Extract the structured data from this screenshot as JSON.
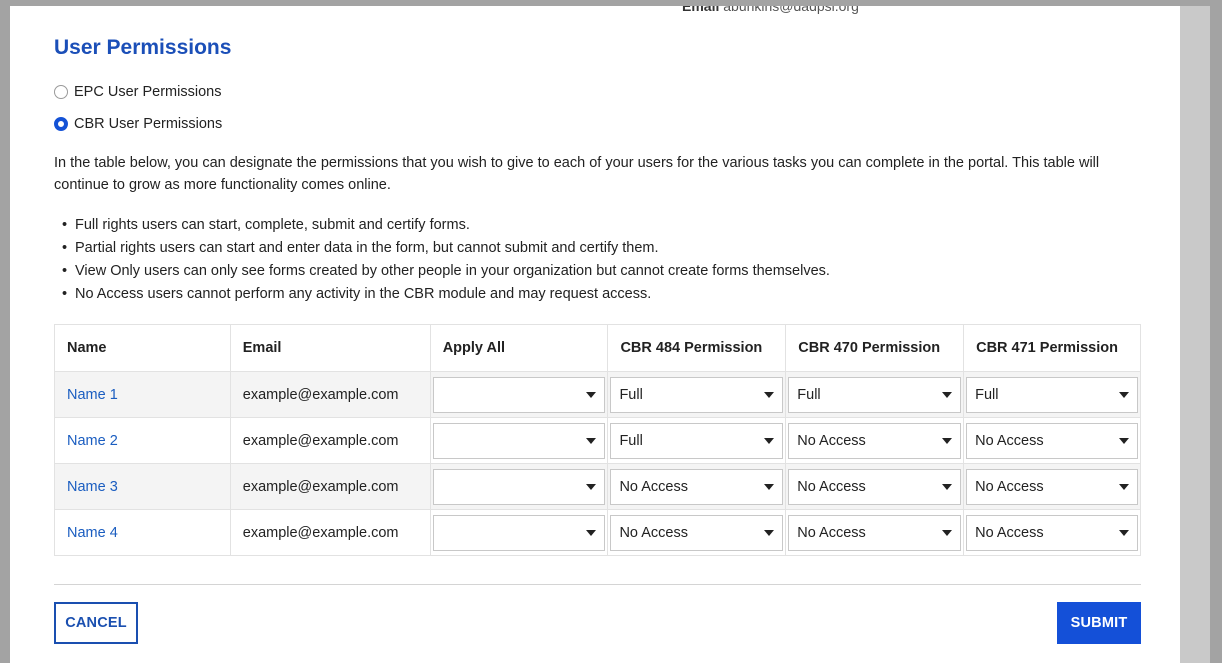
{
  "header": {
    "email_label": "Email",
    "email_value": "abunkins@dadpsi.org"
  },
  "page_title": "User Permissions",
  "permission_types": [
    {
      "label": "EPC User Permissions",
      "selected": false
    },
    {
      "label": "CBR User Permissions",
      "selected": true
    }
  ],
  "description": "In the table below, you can designate the permissions that you wish to give to each of your users for the various tasks you can complete in the portal. This table will continue to grow as more functionality comes online.",
  "bullets": [
    "Full rights users can start, complete, submit and certify forms.",
    "Partial rights users can start and enter data in the form, but cannot submit and certify them.",
    "View Only users can only see forms created by other people in your organization but cannot create forms themselves.",
    "No Access users cannot perform any activity in the CBR module and may request access."
  ],
  "table": {
    "headers": [
      "Name",
      "Email",
      "Apply All",
      "CBR 484 Permission",
      "CBR 470 Permission",
      "CBR 471 Permission"
    ],
    "rows": [
      {
        "name": "Name 1",
        "email": "example@example.com",
        "apply_all": "",
        "cbr484": "Full",
        "cbr470": "Full",
        "cbr471": "Full"
      },
      {
        "name": "Name 2",
        "email": "example@example.com",
        "apply_all": "",
        "cbr484": "Full",
        "cbr470": "No Access",
        "cbr471": "No Access"
      },
      {
        "name": "Name 3",
        "email": "example@example.com",
        "apply_all": "",
        "cbr484": "No Access",
        "cbr470": "No Access",
        "cbr471": "No Access"
      },
      {
        "name": "Name 4",
        "email": "example@example.com",
        "apply_all": "",
        "cbr484": "No Access",
        "cbr470": "No Access",
        "cbr471": "No Access"
      }
    ]
  },
  "actions": {
    "cancel_label": "CANCEL",
    "submit_label": "SUBMIT"
  },
  "colors": {
    "accent": "#1452d6",
    "title": "#1b4fb8",
    "link": "#1a5dc0"
  }
}
